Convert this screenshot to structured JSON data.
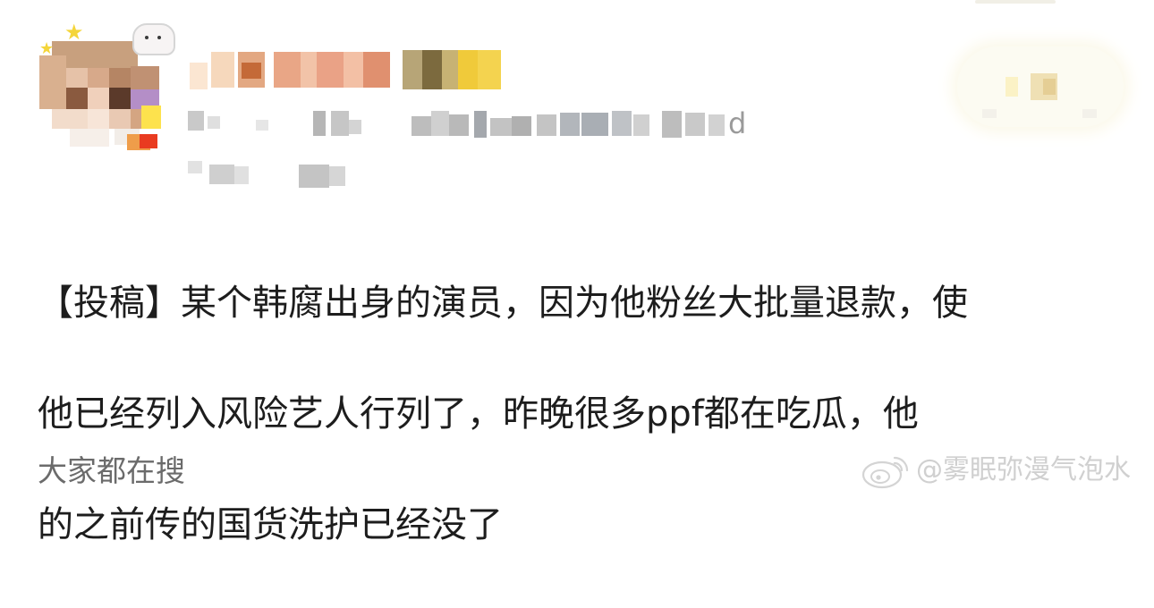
{
  "post": {
    "body_lines": [
      "【投稿】某个韩腐出身的演员，因为他粉丝大批量退款，使",
      "他已经列入风险艺人行列了，昨晚很多ppf都在吃瓜，他",
      "的之前传的国货洗护已经没了"
    ],
    "meta_visible_suffix": "d"
  },
  "footer": {
    "trending_label": "大家都在搜"
  },
  "watermark": {
    "text": "@雾眠弥漫气泡水",
    "icon": "weibo-logo-icon"
  },
  "colors": {
    "body_text": "#1d1d1d",
    "trending_text": "#6b6b6b",
    "watermark_text": "#d0d0d0",
    "meta_text": "#9a9a9a"
  }
}
